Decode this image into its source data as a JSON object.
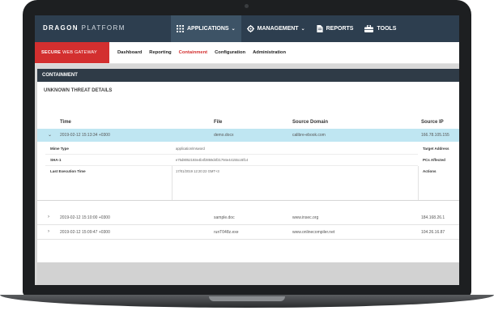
{
  "header": {
    "brand_bold": "DRAGON",
    "brand_light": "PLATFORM",
    "nav": [
      {
        "label": "APPLICATIONS",
        "icon": "grid-icon",
        "dropdown": true
      },
      {
        "label": "MANAGEMENT",
        "icon": "gear-icon",
        "dropdown": true
      },
      {
        "label": "REPORTS",
        "icon": "document-icon",
        "dropdown": false
      },
      {
        "label": "TOOLS",
        "icon": "toolbox-icon",
        "dropdown": false
      }
    ]
  },
  "subheader": {
    "product_bold": "SECURE",
    "product_light": "WEB GATEWAY",
    "tabs": [
      "Dashboard",
      "Reporting",
      "Containment",
      "Configuration",
      "Administration"
    ],
    "active_tab": "Containment"
  },
  "section": {
    "title": "CONTAINMENT",
    "panel_title": "UNKNOWN THREAT DETAILS"
  },
  "table": {
    "columns": [
      "Time",
      "File",
      "Source Domain",
      "Source IP"
    ],
    "rows": [
      {
        "time": "2019-02-12 15:13:34 +0300",
        "file": "demo.docx",
        "domain": "calibre-ebook.com",
        "ip": "166.78.105.155",
        "expanded": true
      },
      {
        "time": "2019-02-12 15:10:00 +0300",
        "file": "sample.doc",
        "domain": "www.insec.org",
        "ip": "184.168.26.1",
        "expanded": false
      },
      {
        "time": "2019-02-12 15:09:47 +0300",
        "file": "runT048z.exe",
        "domain": "www.onlinecompiler.net",
        "ip": "104.26.16.87",
        "expanded": false
      }
    ],
    "details": {
      "mime_label": "Mime Type",
      "mime_value": "application/msword",
      "sha_label": "SHA-1",
      "sha_value": "e75d8052193e4b4f2859d4f21794e44155cc6f14",
      "last_exec_label": "Last Execution Time",
      "last_exec_value": "17/01/2019 12:20:22 GMT+3",
      "right_labels": [
        "Target Address",
        "PCs Affected",
        "Actions"
      ]
    }
  },
  "colors": {
    "topbar": "#2d3e4f",
    "accent_red": "#d32f2f",
    "selected_row": "#bfe6f2",
    "section_bar": "#2f3b47"
  }
}
